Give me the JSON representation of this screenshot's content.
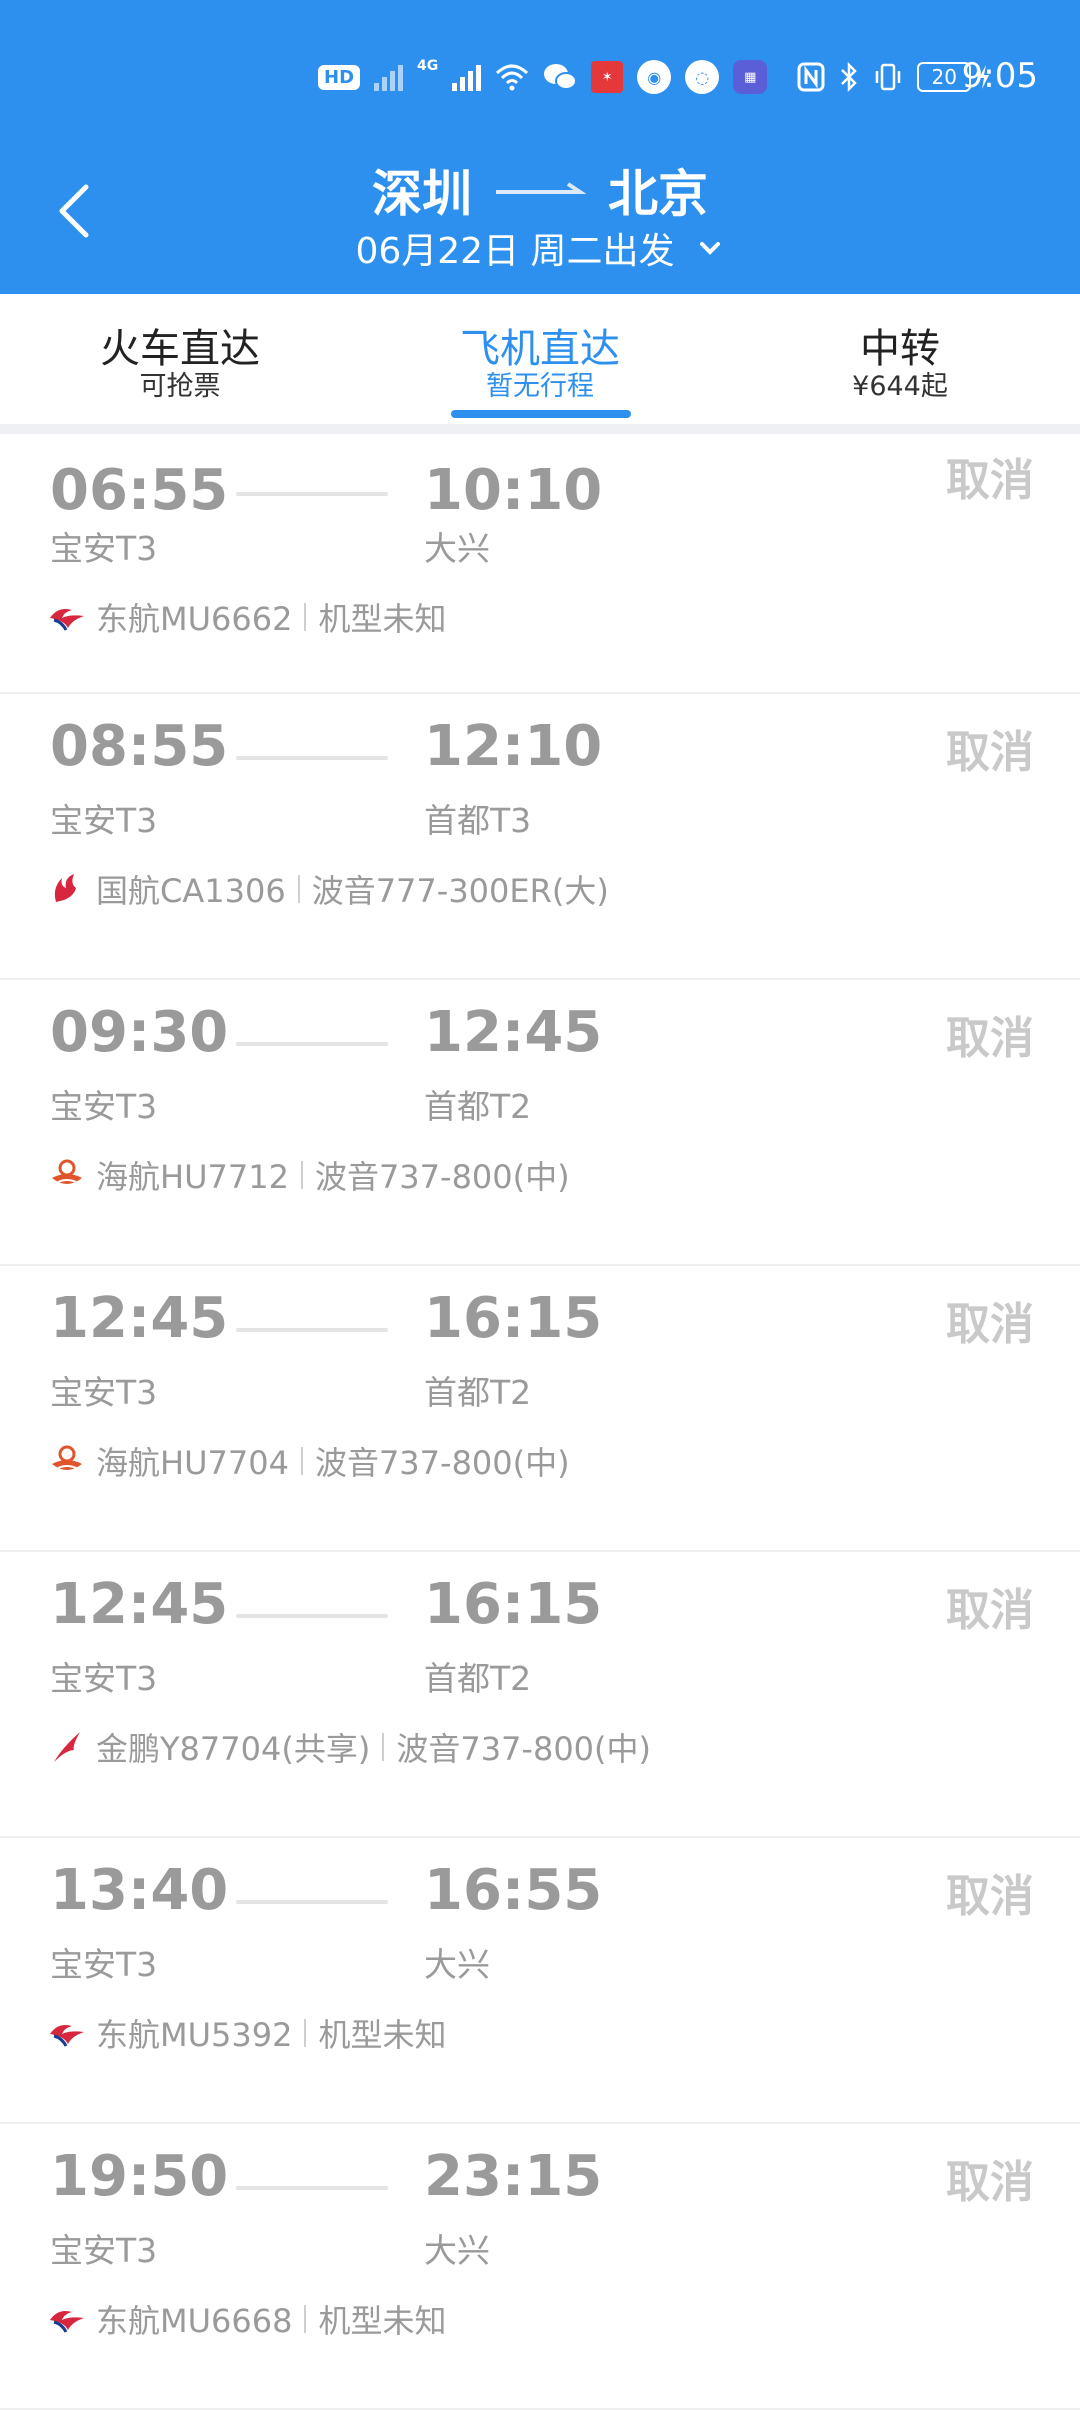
{
  "status_bar": {
    "hd_label": "HD",
    "net_label": "4G",
    "battery": "20",
    "time": "9:05",
    "icons": [
      "hd-icon",
      "signal-icon",
      "signal-icon",
      "wifi-icon",
      "wechat-icon",
      "app-icon",
      "app-icon",
      "app-icon",
      "app-icon",
      "nfc-icon",
      "bluetooth-icon",
      "vibrate-icon",
      "battery-icon"
    ]
  },
  "header": {
    "origin": "深圳",
    "destination": "北京",
    "date": "06月22日 周二出发",
    "accent_color": "#2d90ef"
  },
  "tabs": [
    {
      "title": "火车直达",
      "sub": "可抢票"
    },
    {
      "title": "飞机直达",
      "sub": "暂无行程"
    },
    {
      "title": "中转",
      "sub": "¥644起"
    }
  ],
  "flights": [
    {
      "dep_time": "06:55",
      "arr_time": "10:10",
      "dep_airport": "宝安T3",
      "arr_airport": "大兴",
      "airline": "东航MU6662",
      "aircraft": "机型未知",
      "logo": "china-eastern-logo",
      "action": "取消"
    },
    {
      "dep_time": "08:55",
      "arr_time": "12:10",
      "dep_airport": "宝安T3",
      "arr_airport": "首都T3",
      "airline": "国航CA1306",
      "aircraft": "波音777-300ER(大)",
      "logo": "air-china-logo",
      "action": "取消"
    },
    {
      "dep_time": "09:30",
      "arr_time": "12:45",
      "dep_airport": "宝安T3",
      "arr_airport": "首都T2",
      "airline": "海航HU7712",
      "aircraft": "波音737-800(中)",
      "logo": "hainan-airlines-logo",
      "action": "取消"
    },
    {
      "dep_time": "12:45",
      "arr_time": "16:15",
      "dep_airport": "宝安T3",
      "arr_airport": "首都T2",
      "airline": "海航HU7704",
      "aircraft": "波音737-800(中)",
      "logo": "hainan-airlines-logo",
      "action": "取消"
    },
    {
      "dep_time": "12:45",
      "arr_time": "16:15",
      "dep_airport": "宝安T3",
      "arr_airport": "首都T2",
      "airline": "金鹏Y87704(共享)",
      "aircraft": "波音737-800(中)",
      "logo": "suparna-logo",
      "action": "取消"
    },
    {
      "dep_time": "13:40",
      "arr_time": "16:55",
      "dep_airport": "宝安T3",
      "arr_airport": "大兴",
      "airline": "东航MU5392",
      "aircraft": "机型未知",
      "logo": "china-eastern-logo",
      "action": "取消"
    },
    {
      "dep_time": "19:50",
      "arr_time": "23:15",
      "dep_airport": "宝安T3",
      "arr_airport": "大兴",
      "airline": "东航MU6668",
      "aircraft": "机型未知",
      "logo": "china-eastern-logo",
      "action": "取消"
    }
  ]
}
